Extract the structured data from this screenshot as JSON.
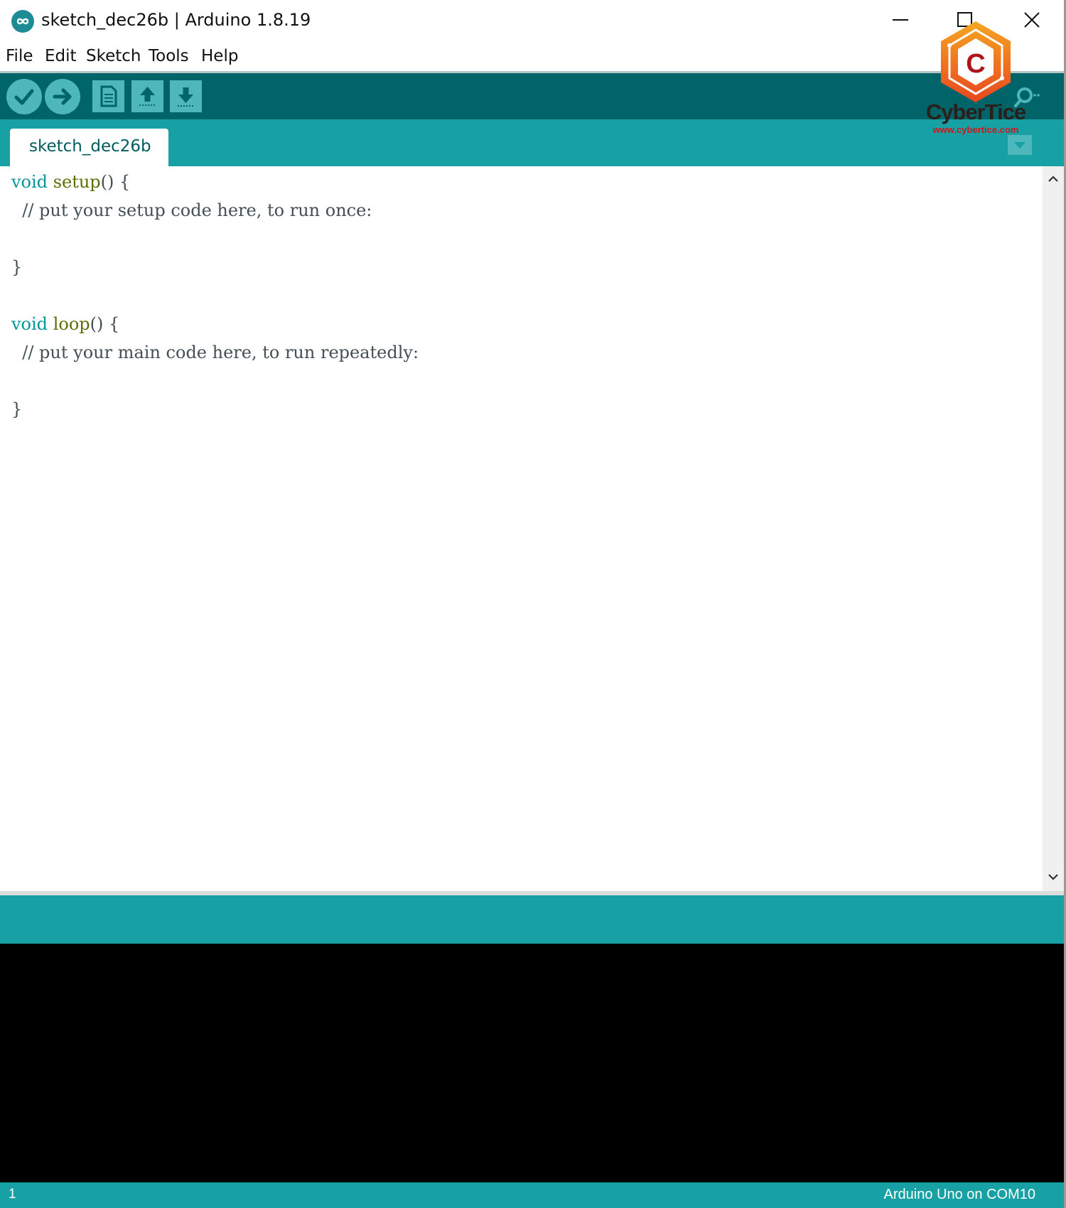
{
  "window": {
    "title": "sketch_dec26b | Arduino 1.8.19",
    "app_icon": "arduino-infinity-icon"
  },
  "menubar": {
    "items": [
      "File",
      "Edit",
      "Sketch",
      "Tools",
      "Help"
    ]
  },
  "toolbar": {
    "buttons": [
      {
        "name": "verify",
        "icon": "check-icon"
      },
      {
        "name": "upload",
        "icon": "arrow-right-icon"
      },
      {
        "name": "new",
        "icon": "page-icon"
      },
      {
        "name": "open",
        "icon": "arrow-up-icon"
      },
      {
        "name": "save",
        "icon": "arrow-down-icon"
      }
    ],
    "serial_monitor_icon": "magnifier-icon"
  },
  "tabs": {
    "active": "sketch_dec26b",
    "menu_icon": "chevron-down-icon"
  },
  "editor": {
    "lines": [
      {
        "type": "void",
        "fn": "setup",
        "rest": "() {"
      },
      {
        "comment": "  // put your setup code here, to run once:"
      },
      {
        "text": ""
      },
      {
        "text": "}"
      },
      {
        "text": ""
      },
      {
        "type": "void",
        "fn": "loop",
        "rest": "() {"
      },
      {
        "comment": "  // put your main code here, to run repeatedly:"
      },
      {
        "text": ""
      },
      {
        "text": "}"
      }
    ]
  },
  "status": {
    "line_number": "1",
    "board": "Arduino Uno on COM10"
  },
  "watermark": {
    "name": "CyberTice",
    "url": "www.cybertice.com",
    "logo_letter": "C"
  },
  "colors": {
    "toolbar_bg": "#006468",
    "accent": "#17a1a5",
    "button_bg": "#4db7bb",
    "keyword_type": "#00979c",
    "keyword_func": "#5e6d03",
    "console_bg": "#000000"
  }
}
